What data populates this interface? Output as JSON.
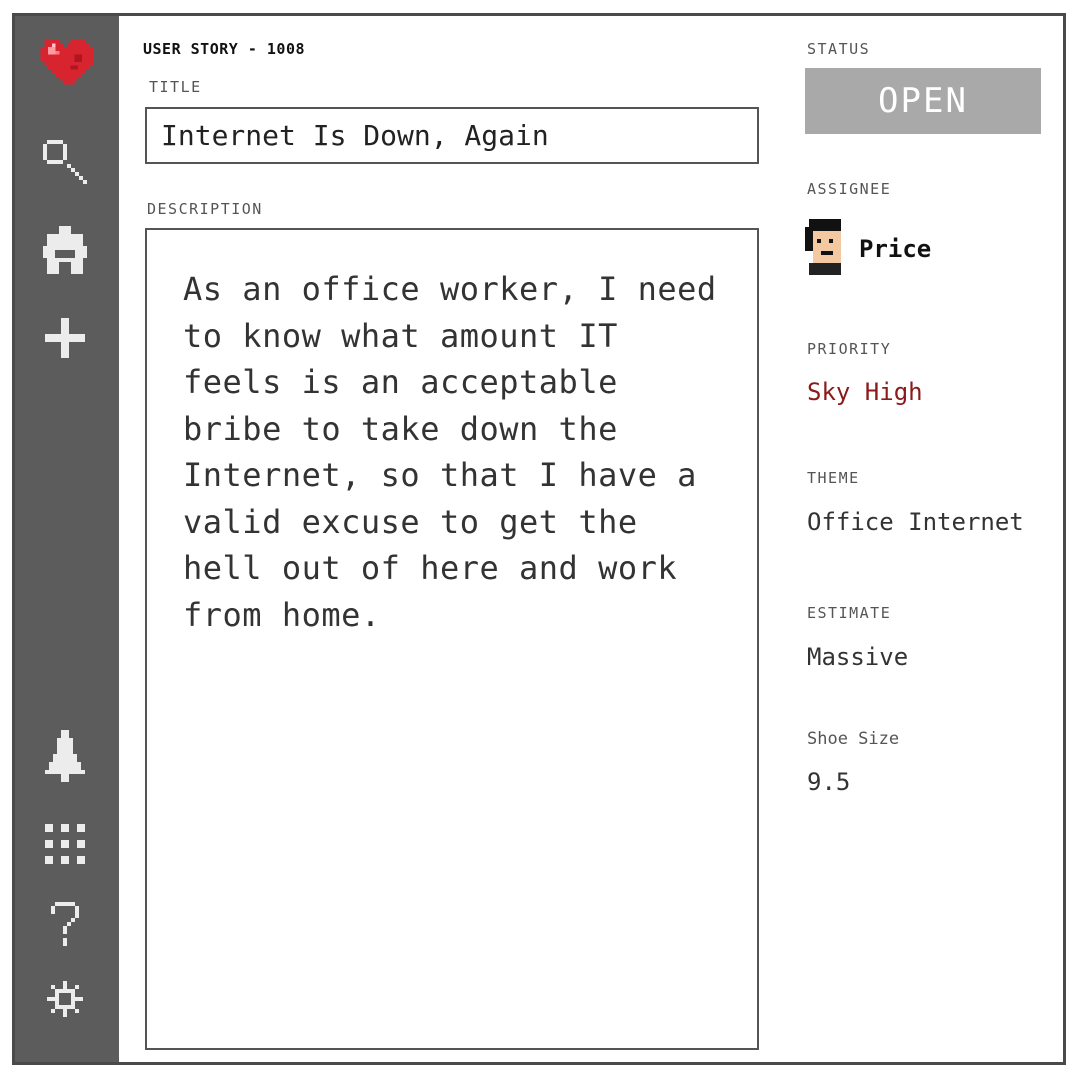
{
  "story": {
    "id_label": "USER STORY - 1008",
    "title_label": "TITLE",
    "title": "Internet Is Down, Again",
    "description_label": "DESCRIPTION",
    "description": "As an office worker, I need to know what amount IT feels is an acceptable bribe to take down the Internet, so that I have a valid excuse to get the hell out of here and work from home."
  },
  "fields": {
    "status_label": "STATUS",
    "status": "OPEN",
    "assignee_label": "ASSIGNEE",
    "assignee": "Price",
    "priority_label": "PRIORITY",
    "priority": "Sky High",
    "theme_label": "THEME",
    "theme": "Office Internet",
    "estimate_label": "ESTIMATE",
    "estimate": "Massive",
    "shoe_size_label": "Shoe Size",
    "shoe_size": "9.5"
  },
  "sidebar": {
    "icons": [
      "heart-logo",
      "search-icon",
      "puzzle-icon",
      "plus-icon",
      "bell-icon",
      "apps-grid-icon",
      "help-icon",
      "settings-gear-icon"
    ]
  },
  "colors": {
    "sidebar": "#5c5c5c",
    "status_button": "#a9a9a9",
    "priority_text": "#8b1a1a",
    "logo_red": "#d8242f"
  }
}
